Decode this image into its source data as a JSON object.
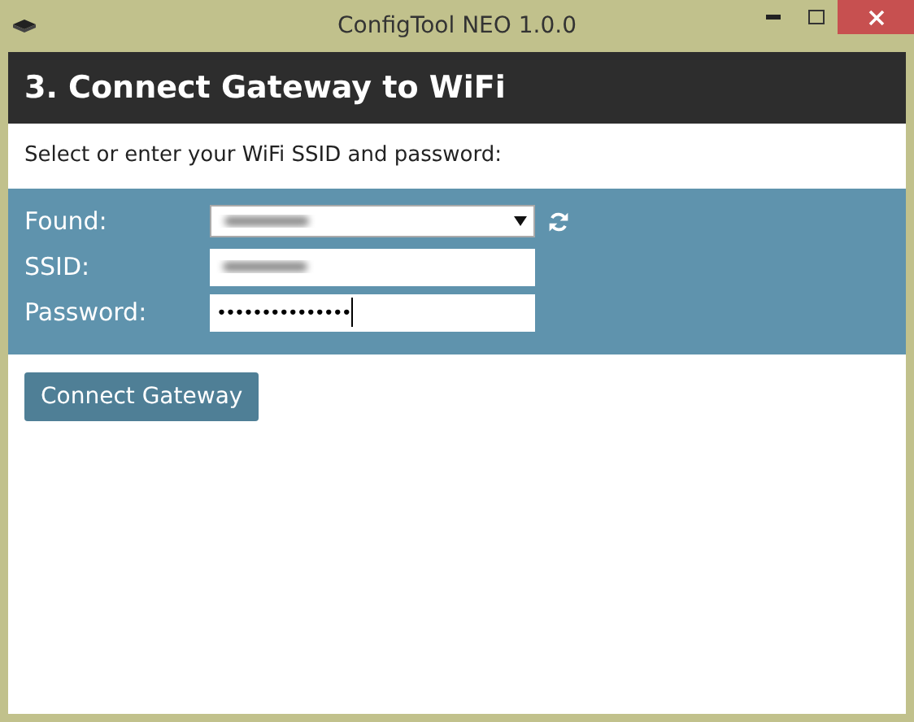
{
  "window": {
    "title": "ConfigTool NEO 1.0.0"
  },
  "header": {
    "title": "3. Connect Gateway to WiFi"
  },
  "instructions": "Select or enter your WiFi SSID and password:",
  "form": {
    "fields": [
      {
        "kind": "select",
        "label": "Found:",
        "redacted": true
      },
      {
        "kind": "text",
        "label": "SSID:",
        "redacted": true
      },
      {
        "kind": "password",
        "label": "Password:",
        "value": "•••••••••••••••",
        "focused": true
      }
    ]
  },
  "buttons": [
    "Connect Gateway"
  ]
}
